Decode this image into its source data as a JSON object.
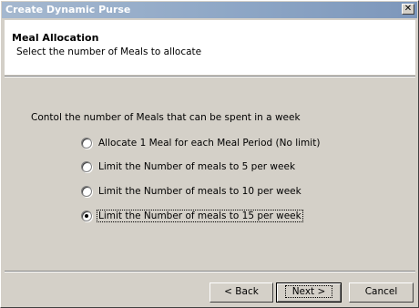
{
  "window": {
    "title": "Create Dynamic Purse",
    "close_glyph": "✕"
  },
  "header": {
    "title": "Meal Allocation",
    "subtitle": "Select the number of Meals to allocate"
  },
  "content": {
    "prompt": "Contol the number of Meals that can be spent in a week",
    "options": [
      {
        "label": "Allocate 1 Meal for each Meal Period (No limit)",
        "selected": false
      },
      {
        "label": "Limit the Number of meals to 5 per week",
        "selected": false
      },
      {
        "label": "Limit the Number of meals to 10 per week",
        "selected": false
      },
      {
        "label": "Limit the Number of meals to 15 per week",
        "selected": true
      }
    ]
  },
  "buttons": {
    "back": "< Back",
    "next": "Next >",
    "cancel": "Cancel"
  },
  "icons": {
    "close": "close-icon",
    "radio": "radio-button"
  }
}
